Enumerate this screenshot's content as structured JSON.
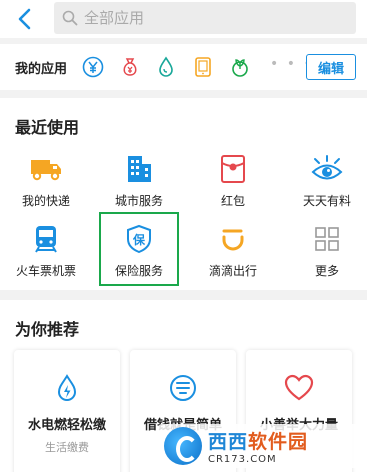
{
  "search": {
    "placeholder": "全部应用"
  },
  "my_apps": {
    "label": "我的应用",
    "more_dots": "• • •",
    "edit_label": "编辑",
    "icons": [
      "yuan-coin-icon",
      "money-bag-icon",
      "water-drop-icon",
      "tablet-icon",
      "plant-icon"
    ]
  },
  "recent": {
    "title": "最近使用",
    "items": [
      {
        "label": "我的快递",
        "icon": "truck-icon",
        "color": "#f5a623"
      },
      {
        "label": "城市服务",
        "icon": "building-icon",
        "color": "#1a8fe0"
      },
      {
        "label": "红包",
        "icon": "red-packet-icon",
        "color": "#e5484d"
      },
      {
        "label": "天天有料",
        "icon": "eye-icon",
        "color": "#1a8fe0"
      },
      {
        "label": "火车票机票",
        "icon": "train-icon",
        "color": "#1a8fe0"
      },
      {
        "label": "保险服务",
        "icon": "shield-icon",
        "color": "#1a8fe0"
      },
      {
        "label": "滴滴出行",
        "icon": "didi-icon",
        "color": "#f5a623"
      },
      {
        "label": "更多",
        "icon": "grid-icon",
        "color": "#999999"
      }
    ]
  },
  "recommend": {
    "title": "为你推荐",
    "cards": [
      {
        "title": "水电燃轻松缴",
        "sub": "生活缴费",
        "icon": "lightning-drop-icon"
      },
      {
        "title": "借钱就是简单",
        "sub": "蚂",
        "icon": "loan-icon"
      },
      {
        "title": "小善举大力量",
        "sub": "",
        "icon": "heart-icon"
      }
    ]
  },
  "watermark": {
    "name_blue": "西西",
    "name_orange": "软件园",
    "url": "CR173.COM"
  },
  "colors": {
    "accent": "#1a8fe0",
    "selected": "#1aa84b"
  }
}
